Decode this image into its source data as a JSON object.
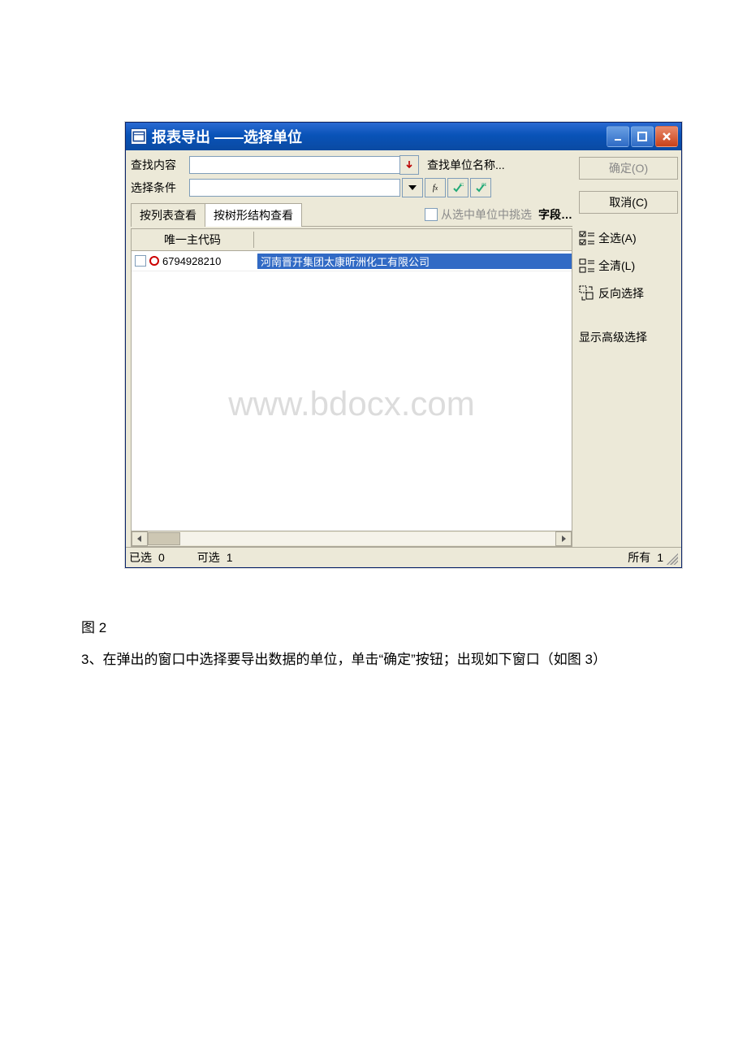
{
  "window": {
    "title": "报表导出 ——选择单位",
    "search": {
      "find_label": "查找内容",
      "cond_label": "选择条件",
      "find_name_label": "查找单位名称...",
      "pick_from_selected_label": "从选中单位中挑选",
      "field_button": "字段…"
    },
    "tabs": {
      "list": "按列表查看",
      "tree": "按树形结构查看"
    },
    "grid": {
      "col_code": "唯一主代码",
      "rows": [
        {
          "code": "6794928210",
          "name": "河南晋开集团太康昕洲化工有限公司"
        }
      ]
    },
    "watermark": "www.bdocx.com",
    "actions": {
      "ok": "确定(O)",
      "cancel": "取消(C)",
      "select_all": "全选(A)",
      "clear_all": "全清(L)",
      "invert": "反向选择",
      "adv": "显示高级选择"
    },
    "status": {
      "selected_label": "已选",
      "selected_value": "0",
      "avail_label": "可选",
      "avail_value": "1",
      "all_label": "所有",
      "all_value": "1"
    }
  },
  "caption": {
    "fig": "图 2",
    "step": "3、在弹出的窗口中选择要导出数据的单位，单击“确定”按钮；出现如下窗口（如图 3）"
  }
}
